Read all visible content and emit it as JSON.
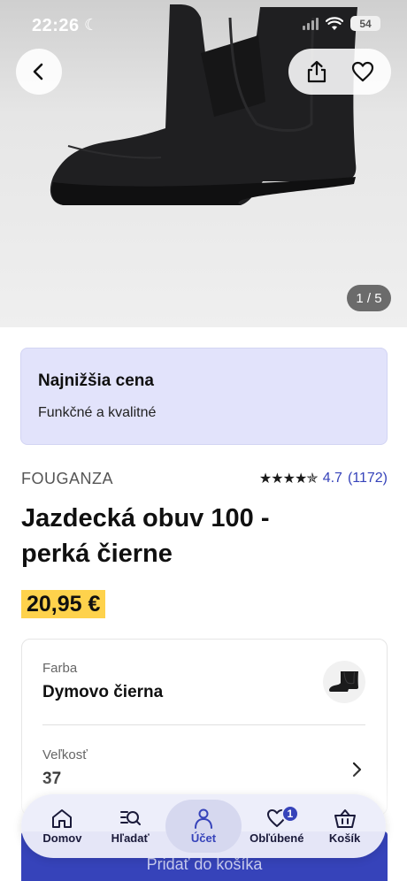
{
  "status_bar": {
    "time": "22:26",
    "battery": "54"
  },
  "gallery": {
    "counter": "1 / 5"
  },
  "promo": {
    "title": "Najnižšia cena",
    "subtitle": "Funkčné a kvalitné"
  },
  "product": {
    "brand": "FOUGANZA",
    "rating_stars": "★★★★✯",
    "rating_value": "4.7",
    "rating_count": "(1172)",
    "title_line1": "Jazdecká obuv 100 -",
    "title_line2": "perká čierne",
    "price": "20,95 €"
  },
  "options": {
    "color_label": "Farba",
    "color_value": "Dymovo čierna",
    "size_label": "Veľkosť",
    "size_value": "37"
  },
  "cta": {
    "label": "Pridať do košíka"
  },
  "tabbar": {
    "items": [
      {
        "label": "Domov",
        "icon": "home-icon"
      },
      {
        "label": "Hľadať",
        "icon": "search-icon"
      },
      {
        "label": "Účet",
        "icon": "account-icon"
      },
      {
        "label": "Obľúbené",
        "icon": "heart-icon",
        "badge": "1"
      },
      {
        "label": "Košík",
        "icon": "basket-icon"
      }
    ]
  },
  "colors": {
    "accent": "#3643ba",
    "price_bg": "#fed24c",
    "promo_bg": "#e2e3fb"
  }
}
